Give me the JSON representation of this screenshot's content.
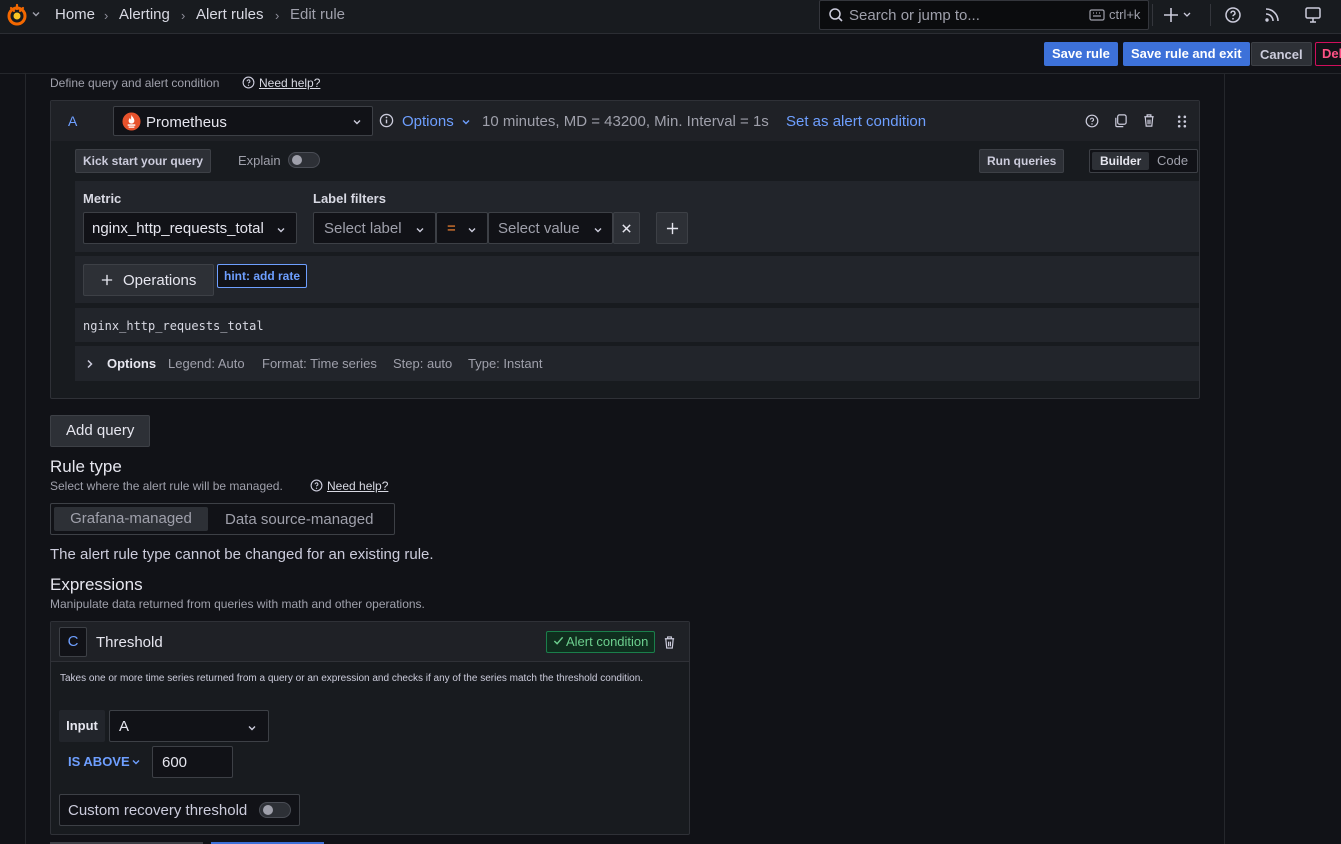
{
  "breadcrumb": [
    "Home",
    "Alerting",
    "Alert rules",
    "Edit rule"
  ],
  "search": {
    "placeholder": "Search or jump to...",
    "shortcut": "ctrl+k"
  },
  "actions": {
    "save": "Save rule",
    "save_exit": "Save rule and exit",
    "cancel": "Cancel",
    "delete": "Del"
  },
  "query_section": {
    "subtitle": "Define query and alert condition",
    "help": "Need help?",
    "query": {
      "ref": "A",
      "datasource": "Prometheus",
      "options_label": "Options",
      "options_meta": "10 minutes, MD = 43200, Min. Interval = 1s",
      "set_condition": "Set as alert condition",
      "kick_start": "Kick start your query",
      "explain": "Explain",
      "run_queries": "Run queries",
      "mode_builder": "Builder",
      "mode_code": "Code",
      "metric_label": "Metric",
      "metric_value": "nginx_http_requests_total",
      "label_filters_label": "Label filters",
      "select_label_ph": "Select label",
      "operator": "=",
      "select_value_ph": "Select value",
      "operations": "Operations",
      "hint": "hint: add rate",
      "promql": "nginx_http_requests_total",
      "options_title": "Options",
      "legend": "Legend: Auto",
      "format": "Format: Time series",
      "step": "Step: auto",
      "type": "Type: Instant"
    },
    "add_query": "Add query"
  },
  "rule_type": {
    "title": "Rule type",
    "subtitle": "Select where the alert rule will be managed.",
    "help": "Need help?",
    "option_grafana": "Grafana-managed",
    "option_ds": "Data source-managed",
    "note": "The alert rule type cannot be changed for an existing rule."
  },
  "expressions": {
    "title": "Expressions",
    "subtitle": "Manipulate data returned from queries with math and other operations.",
    "card": {
      "ref": "C",
      "title": "Threshold",
      "badge": "Alert condition",
      "description": "Takes one or more time series returned from a query or an expression and checks if any of the series match the threshold condition.",
      "input_label": "Input",
      "input_value": "A",
      "comparator": "IS ABOVE",
      "threshold": "600",
      "recovery": "Custom recovery threshold"
    }
  },
  "colors": {
    "primary": "#3d71d9",
    "link": "#6e9fff",
    "danger": "#d10e5c",
    "success": "#6ccf8e",
    "brand": "#f46800"
  }
}
